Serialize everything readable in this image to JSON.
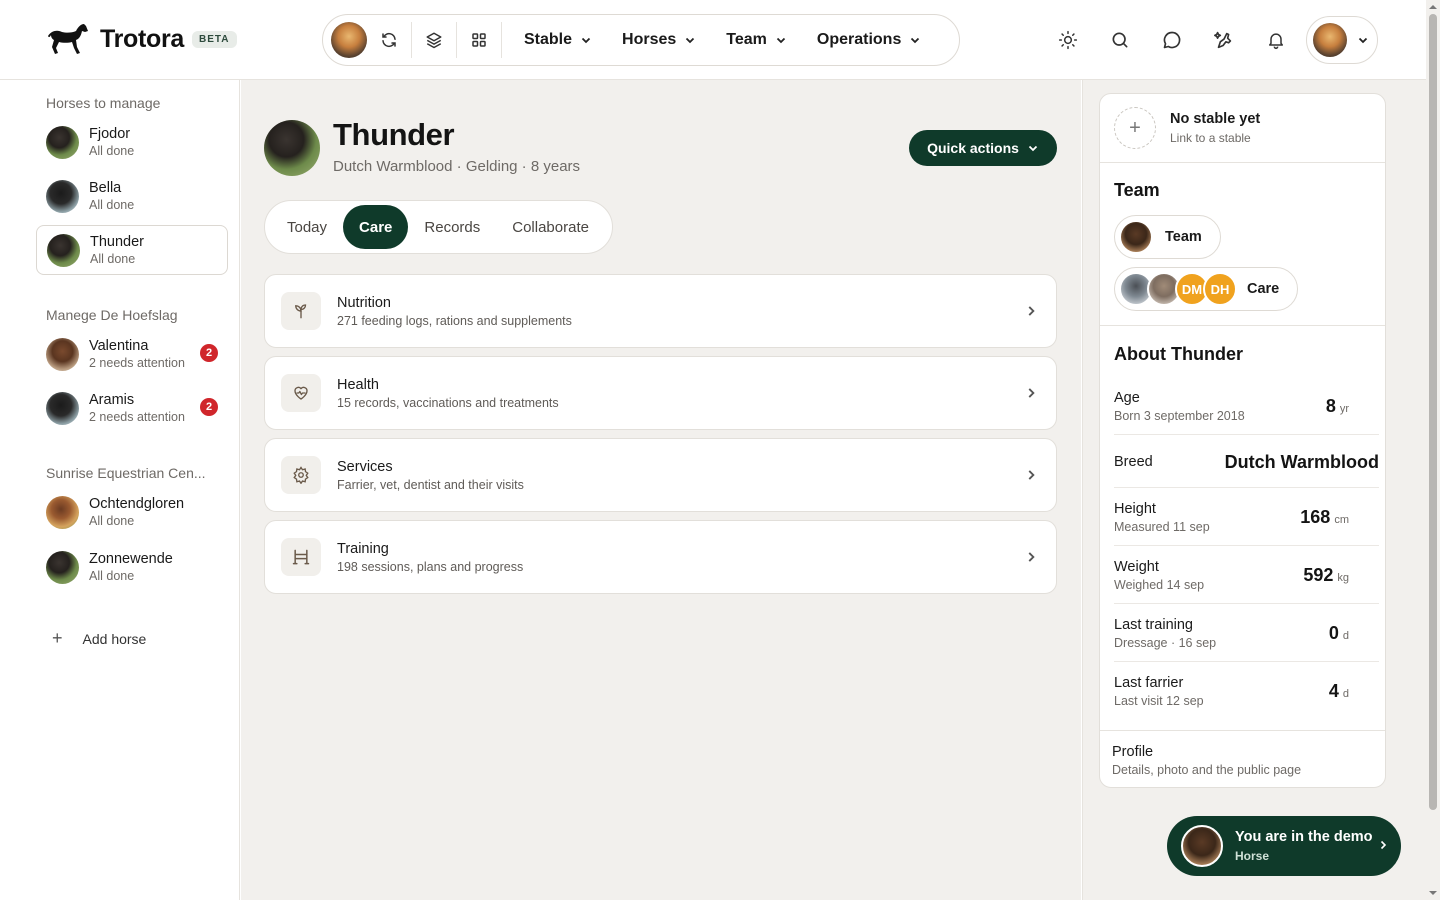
{
  "app": {
    "name": "Trotora",
    "badge": "BETA"
  },
  "nav": {
    "menus": [
      {
        "label": "Stable"
      },
      {
        "label": "Horses"
      },
      {
        "label": "Team"
      },
      {
        "label": "Operations"
      }
    ]
  },
  "sidebar": {
    "groups": [
      {
        "title": "Horses to manage",
        "horses": [
          {
            "name": "Fjodor",
            "status": "All done"
          },
          {
            "name": "Bella",
            "status": "All done"
          },
          {
            "name": "Thunder",
            "status": "All done"
          }
        ]
      },
      {
        "title": "Manege De Hoefslag",
        "horses": [
          {
            "name": "Valentina",
            "status": "2 needs attention",
            "badge": "2"
          },
          {
            "name": "Aramis",
            "status": "2 needs attention",
            "badge": "2"
          }
        ]
      },
      {
        "title": "Sunrise Equestrian Cen...",
        "horses": [
          {
            "name": "Ochtendgloren",
            "status": "All done"
          },
          {
            "name": "Zonnewende",
            "status": "All done"
          }
        ]
      }
    ],
    "add_label": "Add horse"
  },
  "horse": {
    "name": "Thunder",
    "meta": "Dutch Warmblood · Gelding · 8 years",
    "quick_actions": "Quick actions"
  },
  "tabs": [
    {
      "label": "Today"
    },
    {
      "label": "Care",
      "active": true
    },
    {
      "label": "Records"
    },
    {
      "label": "Collaborate"
    }
  ],
  "care_cards": [
    {
      "title": "Nutrition",
      "subtitle": "271 feeding logs, rations and supplements",
      "icon": "sprout-icon"
    },
    {
      "title": "Health",
      "subtitle": "15 records, vaccinations and treatments",
      "icon": "heart-pulse-icon"
    },
    {
      "title": "Services",
      "subtitle": "Farrier, vet, dentist and their visits",
      "icon": "gear-icon"
    },
    {
      "title": "Training",
      "subtitle": "198 sessions, plans and progress",
      "icon": "hurdle-icon"
    }
  ],
  "right": {
    "stable": {
      "title": "No stable yet",
      "subtitle": "Link to a stable"
    },
    "team": {
      "title": "Team",
      "pills": [
        {
          "label": "Team"
        },
        {
          "label": "Care",
          "initials": [
            "DM",
            "DH"
          ]
        }
      ]
    },
    "about": {
      "title": "About Thunder",
      "rows": [
        {
          "label": "Age",
          "sub": "Born 3 september 2018",
          "value": "8",
          "unit": "yr"
        },
        {
          "label": "Breed",
          "value": "Dutch Warmblood"
        },
        {
          "label": "Height",
          "sub": "Measured 11 sep",
          "value": "168",
          "unit": "cm"
        },
        {
          "label": "Weight",
          "sub": "Weighed 14 sep",
          "value": "592",
          "unit": "kg"
        },
        {
          "label": "Last training",
          "sub": "Dressage · 16 sep",
          "value": "0",
          "unit": "d"
        },
        {
          "label": "Last farrier",
          "sub": "Last visit 12 sep",
          "value": "4",
          "unit": "d"
        }
      ]
    },
    "profile": {
      "title": "Profile",
      "subtitle": "Details, photo and the public page"
    }
  },
  "demo": {
    "title": "You are in the demo",
    "subtitle": "Horse"
  },
  "colors": {
    "accent": "#0f3a2a",
    "badge": "#d0262b",
    "initials": "#f0a21e"
  }
}
